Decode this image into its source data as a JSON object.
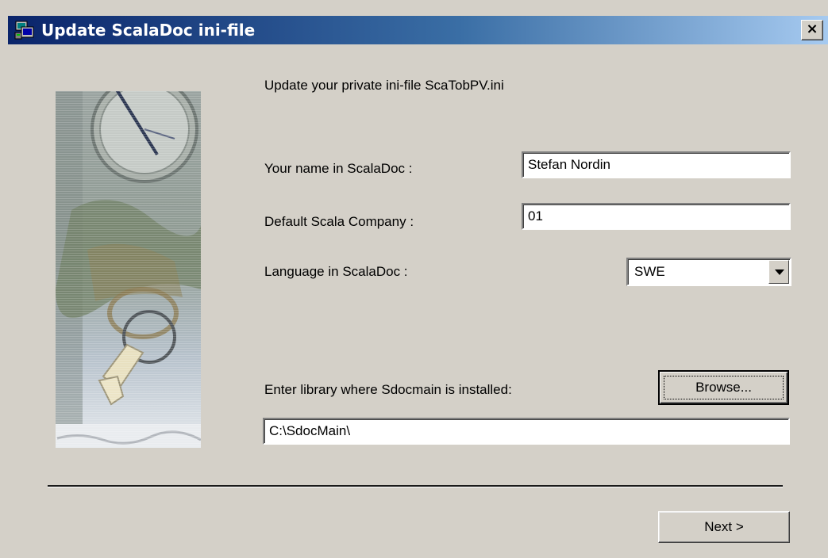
{
  "window": {
    "title": "Update ScalaDoc ini-file",
    "close_label": "×"
  },
  "intro": {
    "text": "Update your private ini-file ScaTobPV.ini"
  },
  "form": {
    "name_label": "Your name in ScalaDoc :",
    "name_value": "Stefan Nordin",
    "company_label": "Default Scala Company :",
    "company_value": "01",
    "language_label": "Language in ScalaDoc :",
    "language_value": "SWE",
    "library_label": "Enter library where Sdocmain is installed:",
    "library_value": "C:\\SdocMain\\"
  },
  "buttons": {
    "browse_label": "Browse...",
    "next_label": "Next >"
  },
  "colors": {
    "titlebar_start": "#0a246a",
    "titlebar_end": "#a6caf0",
    "face": "#d4d0c8"
  },
  "icons": {
    "app": "setup-computer-icon",
    "close": "close-icon",
    "dropdown": "chevron-down-icon"
  }
}
